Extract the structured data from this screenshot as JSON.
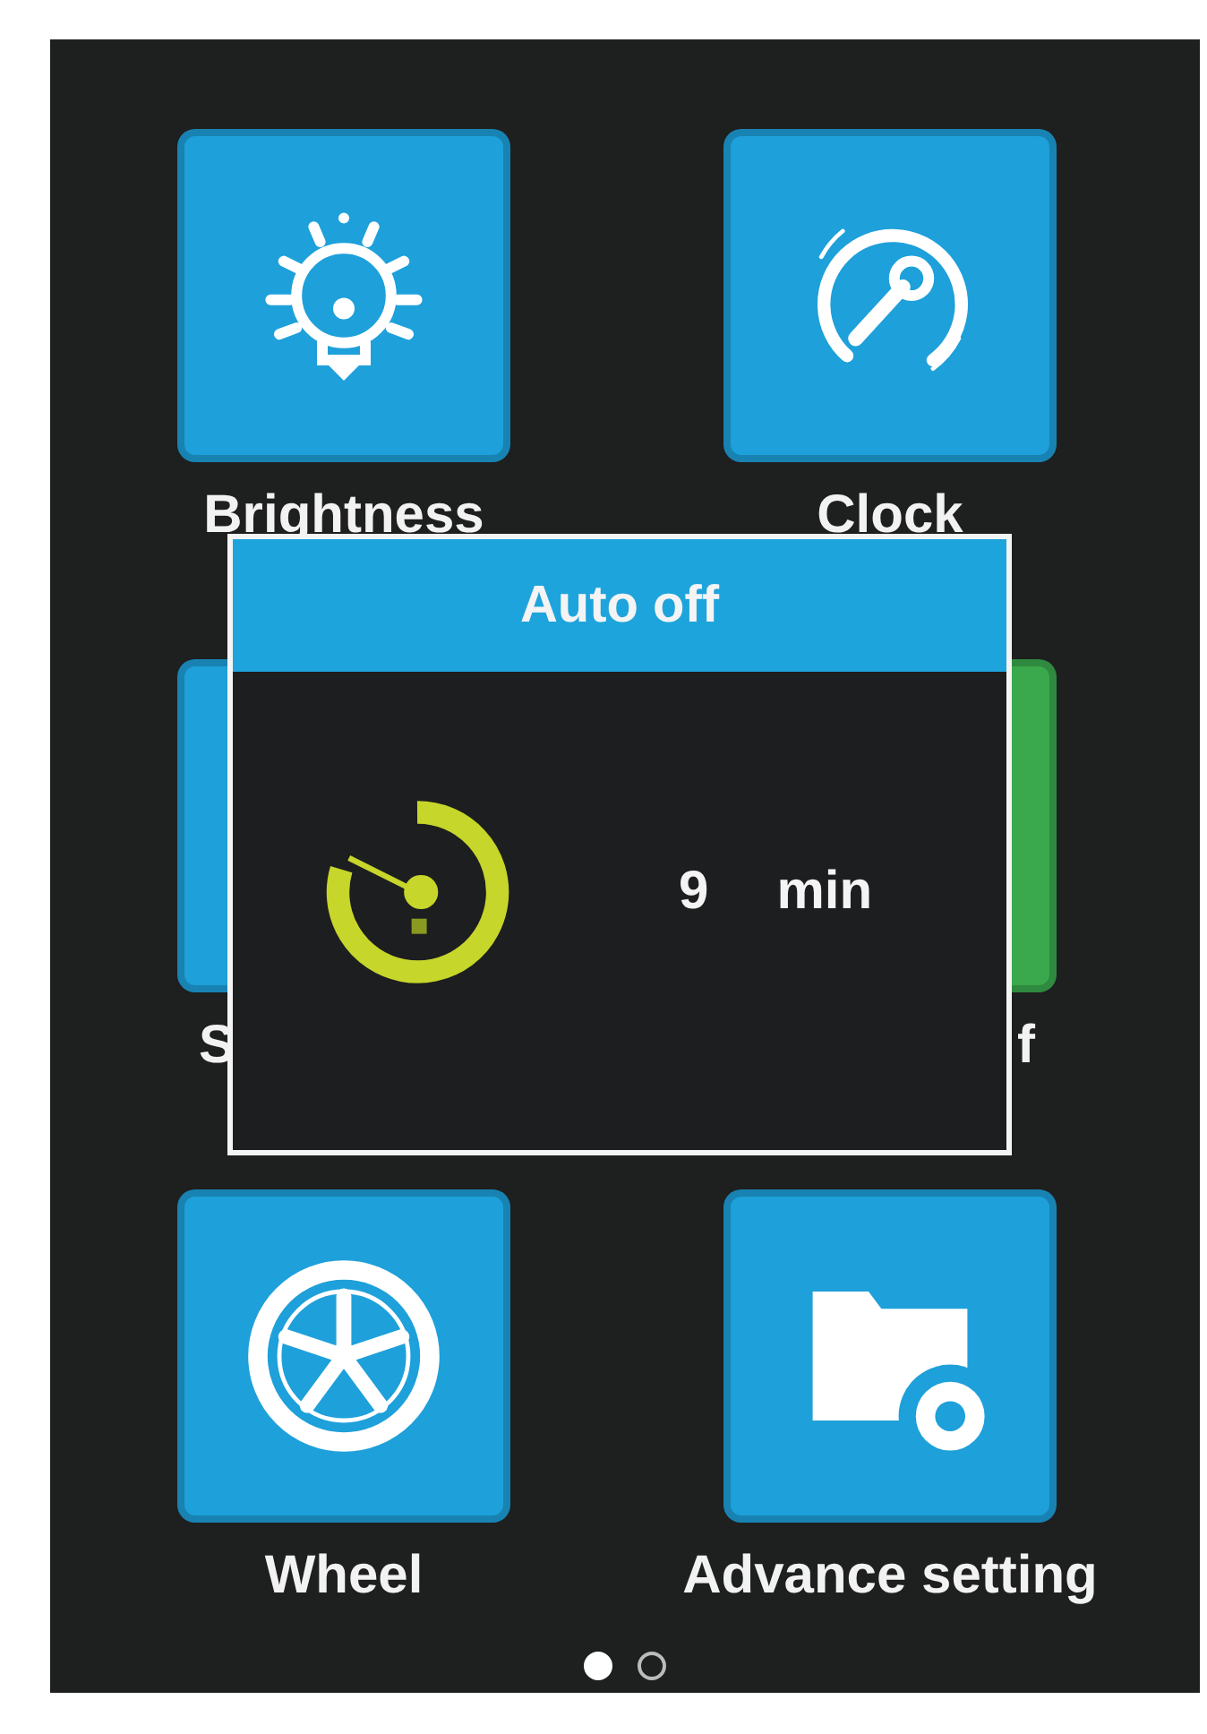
{
  "tiles": [
    {
      "label": "Brightness",
      "kind": "bulb",
      "color": "#1ea0da",
      "covered": false
    },
    {
      "label": "Clock",
      "kind": "gauge",
      "color": "#1ea0da",
      "covered": false
    },
    {
      "label": "S",
      "color": "#1ea0da",
      "covered": true
    },
    {
      "label": "f",
      "color": "#3aa84c",
      "covered": true
    },
    {
      "label": "Wheel",
      "kind": "wheel",
      "color": "#1ea0da",
      "covered": false
    },
    {
      "label": "Advance setting",
      "kind": "folder",
      "color": "#1ea0da",
      "covered": false
    }
  ],
  "pager": [
    {
      "selected": true
    },
    {
      "selected": false
    }
  ],
  "dialog": {
    "title": "Auto off",
    "value": "9",
    "unit": "min"
  }
}
